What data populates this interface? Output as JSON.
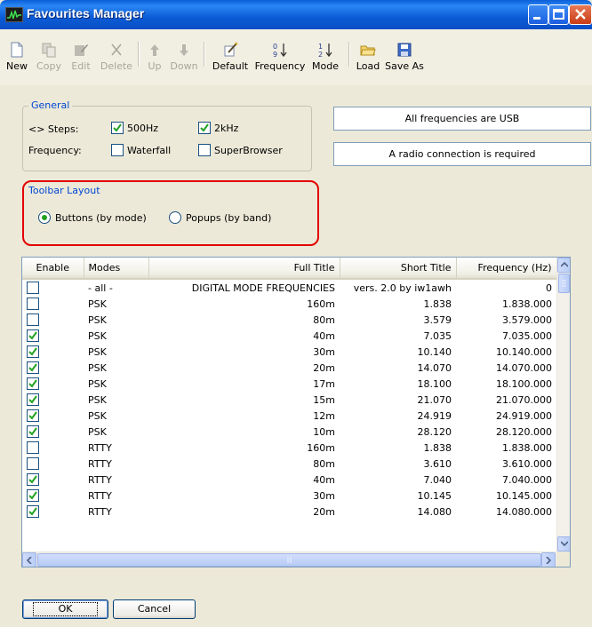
{
  "window": {
    "title": "Favourites Manager",
    "accent": "#0a5fd8"
  },
  "toolbar": [
    {
      "key": "new",
      "label": "New",
      "icon": "new-file-icon",
      "enabled": true
    },
    {
      "key": "copy",
      "label": "Copy",
      "icon": "copy-icon",
      "enabled": false
    },
    {
      "key": "edit",
      "label": "Edit",
      "icon": "edit-icon",
      "enabled": false
    },
    {
      "key": "delete",
      "label": "Delete",
      "icon": "delete-x-icon",
      "enabled": false
    },
    {
      "key": "up",
      "label": "Up",
      "icon": "arrow-up-icon",
      "enabled": false
    },
    {
      "key": "down",
      "label": "Down",
      "icon": "arrow-down-icon",
      "enabled": false
    },
    {
      "key": "default",
      "label": "Default",
      "icon": "wand-icon",
      "enabled": true
    },
    {
      "key": "frequency",
      "label": "Frequency",
      "icon": "sort-numeric-icon",
      "enabled": true
    },
    {
      "key": "mode",
      "label": "Mode",
      "icon": "sort-alpha-icon",
      "enabled": true
    },
    {
      "key": "load",
      "label": "Load",
      "icon": "folder-open-icon",
      "enabled": true
    },
    {
      "key": "saveas",
      "label": "Save As",
      "icon": "floppy-disk-icon",
      "enabled": true
    }
  ],
  "general": {
    "legend": "General",
    "steps_label": "<> Steps:",
    "step_500": {
      "label": "500Hz",
      "checked": true
    },
    "step_2k": {
      "label": "2kHz",
      "checked": true
    },
    "frequency_label": "Frequency:",
    "waterfall": {
      "label": "Waterfall",
      "checked": false
    },
    "superbrowser": {
      "label": "SuperBrowser",
      "checked": false
    }
  },
  "info": {
    "usb": "All frequencies are USB",
    "radio": "A radio connection is required"
  },
  "toolbar_layout": {
    "legend": "Toolbar Layout",
    "options": [
      {
        "label": "Buttons (by mode)",
        "selected": true
      },
      {
        "label": "Popups (by band)",
        "selected": false
      }
    ]
  },
  "table": {
    "columns": [
      "Enable",
      "Modes",
      "Full Title",
      "Short Title",
      "Frequency (Hz)"
    ],
    "rows": [
      {
        "enabled": false,
        "mode": "- all -",
        "full": "DIGITAL MODE FREQUENCIES",
        "short": "vers. 2.0 by iw1awh",
        "freq": "0"
      },
      {
        "enabled": false,
        "mode": "PSK",
        "full": "160m",
        "short": "1.838",
        "freq": "1.838.000"
      },
      {
        "enabled": false,
        "mode": "PSK",
        "full": "80m",
        "short": "3.579",
        "freq": "3.579.000"
      },
      {
        "enabled": true,
        "mode": "PSK",
        "full": "40m",
        "short": "7.035",
        "freq": "7.035.000"
      },
      {
        "enabled": true,
        "mode": "PSK",
        "full": "30m",
        "short": "10.140",
        "freq": "10.140.000"
      },
      {
        "enabled": true,
        "mode": "PSK",
        "full": "20m",
        "short": "14.070",
        "freq": "14.070.000"
      },
      {
        "enabled": true,
        "mode": "PSK",
        "full": "17m",
        "short": "18.100",
        "freq": "18.100.000"
      },
      {
        "enabled": true,
        "mode": "PSK",
        "full": "15m",
        "short": "21.070",
        "freq": "21.070.000"
      },
      {
        "enabled": true,
        "mode": "PSK",
        "full": "12m",
        "short": "24.919",
        "freq": "24.919.000"
      },
      {
        "enabled": true,
        "mode": "PSK",
        "full": "10m",
        "short": "28.120",
        "freq": "28.120.000"
      },
      {
        "enabled": false,
        "mode": "RTTY",
        "full": "160m",
        "short": "1.838",
        "freq": "1.838.000"
      },
      {
        "enabled": false,
        "mode": "RTTY",
        "full": "80m",
        "short": "3.610",
        "freq": "3.610.000"
      },
      {
        "enabled": true,
        "mode": "RTTY",
        "full": "40m",
        "short": "7.040",
        "freq": "7.040.000"
      },
      {
        "enabled": true,
        "mode": "RTTY",
        "full": "30m",
        "short": "10.145",
        "freq": "10.145.000"
      },
      {
        "enabled": true,
        "mode": "RTTY",
        "full": "20m",
        "short": "14.080",
        "freq": "14.080.000"
      }
    ]
  },
  "scroll_icon": "grip-icon",
  "buttons": {
    "ok": "OK",
    "cancel": "Cancel"
  }
}
